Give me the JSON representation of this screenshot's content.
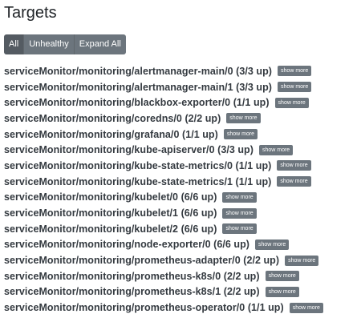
{
  "header": {
    "title": "Targets"
  },
  "filters": [
    {
      "label": "All",
      "active": true
    },
    {
      "label": "Unhealthy",
      "active": false
    },
    {
      "label": "Expand All",
      "active": false
    }
  ],
  "show_more_label": "show more",
  "targets": [
    {
      "name": "serviceMonitor/monitoring/alertmanager-main/0 (3/3 up)"
    },
    {
      "name": "serviceMonitor/monitoring/alertmanager-main/1 (3/3 up)"
    },
    {
      "name": "serviceMonitor/monitoring/blackbox-exporter/0 (1/1 up)"
    },
    {
      "name": "serviceMonitor/monitoring/coredns/0 (2/2 up)"
    },
    {
      "name": "serviceMonitor/monitoring/grafana/0 (1/1 up)"
    },
    {
      "name": "serviceMonitor/monitoring/kube-apiserver/0 (3/3 up)"
    },
    {
      "name": "serviceMonitor/monitoring/kube-state-metrics/0 (1/1 up)"
    },
    {
      "name": "serviceMonitor/monitoring/kube-state-metrics/1 (1/1 up)"
    },
    {
      "name": "serviceMonitor/monitoring/kubelet/0 (6/6 up)"
    },
    {
      "name": "serviceMonitor/monitoring/kubelet/1 (6/6 up)"
    },
    {
      "name": "serviceMonitor/monitoring/kubelet/2 (6/6 up)"
    },
    {
      "name": "serviceMonitor/monitoring/node-exporter/0 (6/6 up)"
    },
    {
      "name": "serviceMonitor/monitoring/prometheus-adapter/0 (2/2 up)"
    },
    {
      "name": "serviceMonitor/monitoring/prometheus-k8s/0 (2/2 up)"
    },
    {
      "name": "serviceMonitor/monitoring/prometheus-k8s/1 (2/2 up)"
    },
    {
      "name": "serviceMonitor/monitoring/prometheus-operator/0 (1/1 up)"
    }
  ]
}
